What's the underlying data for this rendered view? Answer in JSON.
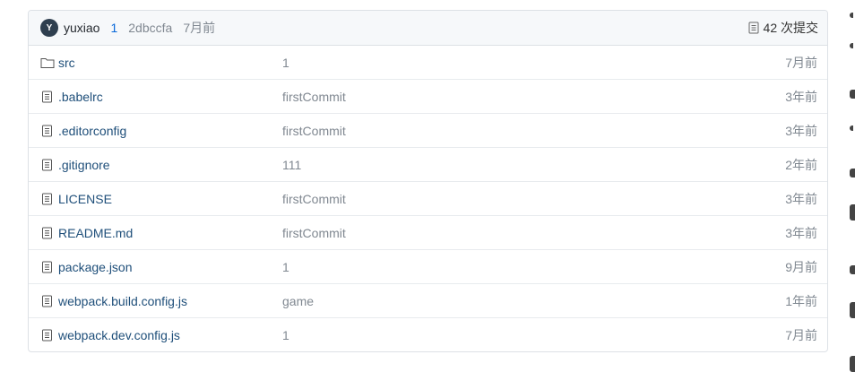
{
  "header": {
    "avatar_initial": "Y",
    "author": "yuxiao",
    "message": "1",
    "sha": "2dbccfa",
    "time": "7月前",
    "commits": "42 次提交"
  },
  "files": [
    {
      "name": "src",
      "type": "folder",
      "commit": "1",
      "time": "7月前"
    },
    {
      "name": ".babelrc",
      "type": "file",
      "commit": "firstCommit",
      "time": "3年前"
    },
    {
      "name": ".editorconfig",
      "type": "file",
      "commit": "firstCommit",
      "time": "3年前"
    },
    {
      "name": ".gitignore",
      "type": "file",
      "commit": "111",
      "time": "2年前"
    },
    {
      "name": "LICENSE",
      "type": "file",
      "commit": "firstCommit",
      "time": "3年前"
    },
    {
      "name": "README.md",
      "type": "file",
      "commit": "firstCommit",
      "time": "3年前"
    },
    {
      "name": "package.json",
      "type": "file",
      "commit": "1",
      "time": "9月前"
    },
    {
      "name": "webpack.build.config.js",
      "type": "file",
      "commit": "game",
      "time": "1年前"
    },
    {
      "name": "webpack.dev.config.js",
      "type": "file",
      "commit": "1",
      "time": "7月前"
    }
  ],
  "colors": {
    "link": "#1f4f7a",
    "accent": "#0969da",
    "muted": "#808891"
  }
}
